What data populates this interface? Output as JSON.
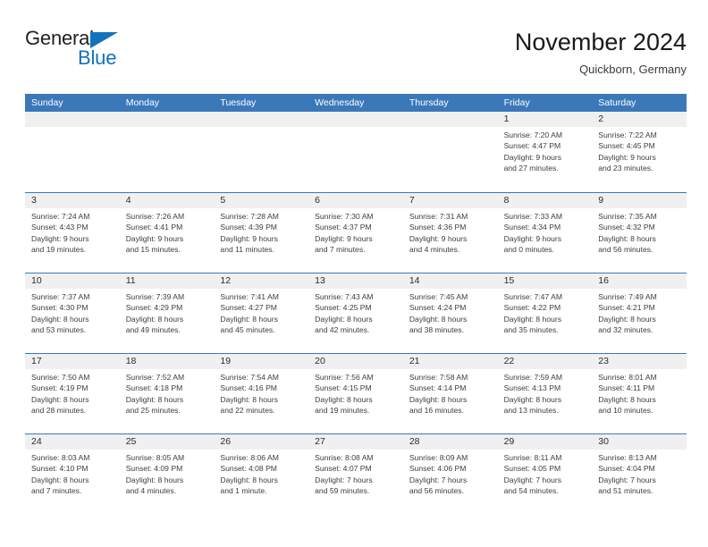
{
  "logo": {
    "word_top": "General",
    "word_bottom": "Blue",
    "triangle_icon": "triangle-icon",
    "brand_color": "#1272bb",
    "text_color": "#231f20"
  },
  "header": {
    "title": "November 2024",
    "subtitle": "Quickborn, Germany"
  },
  "theme": {
    "header_blue": "#3b78ba",
    "day_band_gray": "#f0f0f0",
    "row_rule": "#3b78ba"
  },
  "weekdays": [
    "Sunday",
    "Monday",
    "Tuesday",
    "Wednesday",
    "Thursday",
    "Friday",
    "Saturday"
  ],
  "labels": {
    "sunrise_prefix": "Sunrise:",
    "sunset_prefix": "Sunset:",
    "daylight_prefix": "Daylight:"
  },
  "weeks": [
    [
      {
        "day": "",
        "empty": true
      },
      {
        "day": "",
        "empty": true
      },
      {
        "day": "",
        "empty": true
      },
      {
        "day": "",
        "empty": true
      },
      {
        "day": "",
        "empty": true
      },
      {
        "day": "1",
        "sunrise": "Sunrise: 7:20 AM",
        "sunset": "Sunset: 4:47 PM",
        "daylight_l1": "Daylight: 9 hours",
        "daylight_l2": "and 27 minutes."
      },
      {
        "day": "2",
        "sunrise": "Sunrise: 7:22 AM",
        "sunset": "Sunset: 4:45 PM",
        "daylight_l1": "Daylight: 9 hours",
        "daylight_l2": "and 23 minutes."
      }
    ],
    [
      {
        "day": "3",
        "sunrise": "Sunrise: 7:24 AM",
        "sunset": "Sunset: 4:43 PM",
        "daylight_l1": "Daylight: 9 hours",
        "daylight_l2": "and 19 minutes."
      },
      {
        "day": "4",
        "sunrise": "Sunrise: 7:26 AM",
        "sunset": "Sunset: 4:41 PM",
        "daylight_l1": "Daylight: 9 hours",
        "daylight_l2": "and 15 minutes."
      },
      {
        "day": "5",
        "sunrise": "Sunrise: 7:28 AM",
        "sunset": "Sunset: 4:39 PM",
        "daylight_l1": "Daylight: 9 hours",
        "daylight_l2": "and 11 minutes."
      },
      {
        "day": "6",
        "sunrise": "Sunrise: 7:30 AM",
        "sunset": "Sunset: 4:37 PM",
        "daylight_l1": "Daylight: 9 hours",
        "daylight_l2": "and 7 minutes."
      },
      {
        "day": "7",
        "sunrise": "Sunrise: 7:31 AM",
        "sunset": "Sunset: 4:36 PM",
        "daylight_l1": "Daylight: 9 hours",
        "daylight_l2": "and 4 minutes."
      },
      {
        "day": "8",
        "sunrise": "Sunrise: 7:33 AM",
        "sunset": "Sunset: 4:34 PM",
        "daylight_l1": "Daylight: 9 hours",
        "daylight_l2": "and 0 minutes."
      },
      {
        "day": "9",
        "sunrise": "Sunrise: 7:35 AM",
        "sunset": "Sunset: 4:32 PM",
        "daylight_l1": "Daylight: 8 hours",
        "daylight_l2": "and 56 minutes."
      }
    ],
    [
      {
        "day": "10",
        "sunrise": "Sunrise: 7:37 AM",
        "sunset": "Sunset: 4:30 PM",
        "daylight_l1": "Daylight: 8 hours",
        "daylight_l2": "and 53 minutes."
      },
      {
        "day": "11",
        "sunrise": "Sunrise: 7:39 AM",
        "sunset": "Sunset: 4:29 PM",
        "daylight_l1": "Daylight: 8 hours",
        "daylight_l2": "and 49 minutes."
      },
      {
        "day": "12",
        "sunrise": "Sunrise: 7:41 AM",
        "sunset": "Sunset: 4:27 PM",
        "daylight_l1": "Daylight: 8 hours",
        "daylight_l2": "and 45 minutes."
      },
      {
        "day": "13",
        "sunrise": "Sunrise: 7:43 AM",
        "sunset": "Sunset: 4:25 PM",
        "daylight_l1": "Daylight: 8 hours",
        "daylight_l2": "and 42 minutes."
      },
      {
        "day": "14",
        "sunrise": "Sunrise: 7:45 AM",
        "sunset": "Sunset: 4:24 PM",
        "daylight_l1": "Daylight: 8 hours",
        "daylight_l2": "and 38 minutes."
      },
      {
        "day": "15",
        "sunrise": "Sunrise: 7:47 AM",
        "sunset": "Sunset: 4:22 PM",
        "daylight_l1": "Daylight: 8 hours",
        "daylight_l2": "and 35 minutes."
      },
      {
        "day": "16",
        "sunrise": "Sunrise: 7:49 AM",
        "sunset": "Sunset: 4:21 PM",
        "daylight_l1": "Daylight: 8 hours",
        "daylight_l2": "and 32 minutes."
      }
    ],
    [
      {
        "day": "17",
        "sunrise": "Sunrise: 7:50 AM",
        "sunset": "Sunset: 4:19 PM",
        "daylight_l1": "Daylight: 8 hours",
        "daylight_l2": "and 28 minutes."
      },
      {
        "day": "18",
        "sunrise": "Sunrise: 7:52 AM",
        "sunset": "Sunset: 4:18 PM",
        "daylight_l1": "Daylight: 8 hours",
        "daylight_l2": "and 25 minutes."
      },
      {
        "day": "19",
        "sunrise": "Sunrise: 7:54 AM",
        "sunset": "Sunset: 4:16 PM",
        "daylight_l1": "Daylight: 8 hours",
        "daylight_l2": "and 22 minutes."
      },
      {
        "day": "20",
        "sunrise": "Sunrise: 7:56 AM",
        "sunset": "Sunset: 4:15 PM",
        "daylight_l1": "Daylight: 8 hours",
        "daylight_l2": "and 19 minutes."
      },
      {
        "day": "21",
        "sunrise": "Sunrise: 7:58 AM",
        "sunset": "Sunset: 4:14 PM",
        "daylight_l1": "Daylight: 8 hours",
        "daylight_l2": "and 16 minutes."
      },
      {
        "day": "22",
        "sunrise": "Sunrise: 7:59 AM",
        "sunset": "Sunset: 4:13 PM",
        "daylight_l1": "Daylight: 8 hours",
        "daylight_l2": "and 13 minutes."
      },
      {
        "day": "23",
        "sunrise": "Sunrise: 8:01 AM",
        "sunset": "Sunset: 4:11 PM",
        "daylight_l1": "Daylight: 8 hours",
        "daylight_l2": "and 10 minutes."
      }
    ],
    [
      {
        "day": "24",
        "sunrise": "Sunrise: 8:03 AM",
        "sunset": "Sunset: 4:10 PM",
        "daylight_l1": "Daylight: 8 hours",
        "daylight_l2": "and 7 minutes."
      },
      {
        "day": "25",
        "sunrise": "Sunrise: 8:05 AM",
        "sunset": "Sunset: 4:09 PM",
        "daylight_l1": "Daylight: 8 hours",
        "daylight_l2": "and 4 minutes."
      },
      {
        "day": "26",
        "sunrise": "Sunrise: 8:06 AM",
        "sunset": "Sunset: 4:08 PM",
        "daylight_l1": "Daylight: 8 hours",
        "daylight_l2": "and 1 minute."
      },
      {
        "day": "27",
        "sunrise": "Sunrise: 8:08 AM",
        "sunset": "Sunset: 4:07 PM",
        "daylight_l1": "Daylight: 7 hours",
        "daylight_l2": "and 59 minutes."
      },
      {
        "day": "28",
        "sunrise": "Sunrise: 8:09 AM",
        "sunset": "Sunset: 4:06 PM",
        "daylight_l1": "Daylight: 7 hours",
        "daylight_l2": "and 56 minutes."
      },
      {
        "day": "29",
        "sunrise": "Sunrise: 8:11 AM",
        "sunset": "Sunset: 4:05 PM",
        "daylight_l1": "Daylight: 7 hours",
        "daylight_l2": "and 54 minutes."
      },
      {
        "day": "30",
        "sunrise": "Sunrise: 8:13 AM",
        "sunset": "Sunset: 4:04 PM",
        "daylight_l1": "Daylight: 7 hours",
        "daylight_l2": "and 51 minutes."
      }
    ]
  ]
}
